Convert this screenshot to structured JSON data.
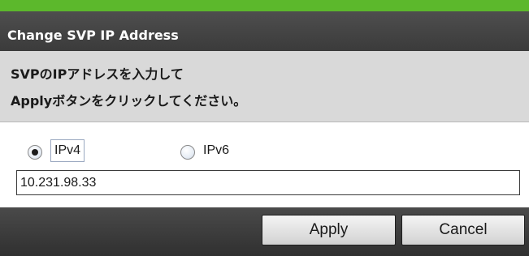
{
  "dialog": {
    "title": "Change SVP IP Address",
    "message_line1": "SVPのIPアドレスを入力して",
    "message_line2": "Applyボタンをクリックしてください。"
  },
  "ip_version": {
    "options": [
      {
        "label": "IPv4",
        "selected": true
      },
      {
        "label": "IPv6",
        "selected": false
      }
    ]
  },
  "ip_address": {
    "value": "10.231.98.33"
  },
  "buttons": {
    "apply_label": "Apply",
    "cancel_label": "Cancel"
  },
  "colors": {
    "accent": "#5cb82c",
    "title_bar": "#444444",
    "message_panel": "#d9d9d9"
  }
}
